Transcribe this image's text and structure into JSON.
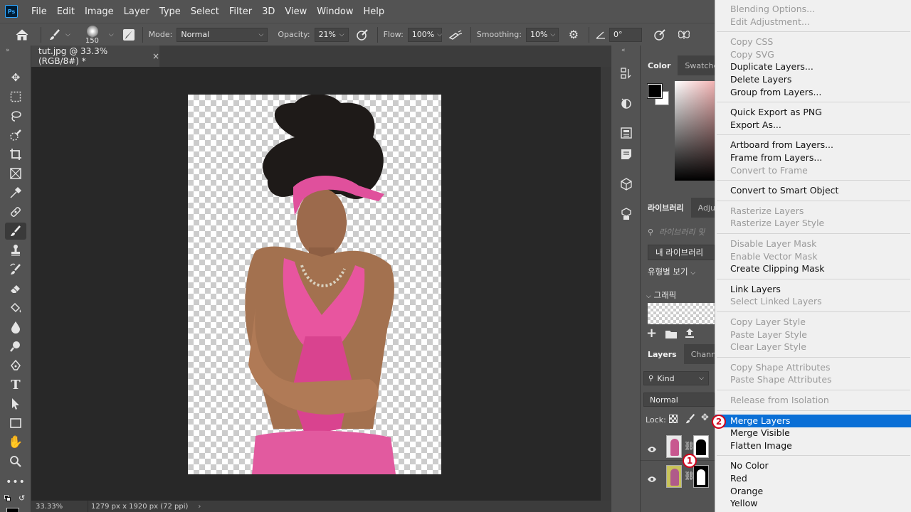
{
  "menubar": {
    "logo": "Ps",
    "items": [
      "File",
      "Edit",
      "Image",
      "Layer",
      "Type",
      "Select",
      "Filter",
      "3D",
      "View",
      "Window",
      "Help"
    ]
  },
  "options": {
    "brush_size": "150",
    "mode_label": "Mode:",
    "mode_value": "Normal",
    "opacity_label": "Opacity:",
    "opacity_value": "21%",
    "flow_label": "Flow:",
    "flow_value": "100%",
    "smoothing_label": "Smoothing:",
    "smoothing_value": "10%",
    "angle_value": "0°"
  },
  "document": {
    "tab_title": "tut.jpg @ 33.3% (RGB/8#) *",
    "close_glyph": "×",
    "zoom": "33.33%",
    "dimensions": "1279 px x 1920 px (72 ppi)"
  },
  "panels": {
    "color_tabs": [
      "Color",
      "Swatches"
    ],
    "library_tabs": [
      "라이브러리",
      "Adju"
    ],
    "library_search_placeholder": "라이브러리 및",
    "my_library": "내 라이브러리",
    "view_by_type": "유형별 보기",
    "graphics_label": "그래픽",
    "layers_tabs": [
      "Layers",
      "Channels"
    ],
    "kind_label": "Kind",
    "blend_mode": "Normal",
    "lock_label": "Lock:"
  },
  "context_menu": {
    "items": [
      {
        "label": "Blending Options...",
        "enabled": false
      },
      {
        "label": "Edit Adjustment...",
        "enabled": false
      },
      {
        "sep": true
      },
      {
        "label": "Copy CSS",
        "enabled": false
      },
      {
        "label": "Copy SVG",
        "enabled": false
      },
      {
        "label": "Duplicate Layers...",
        "enabled": true
      },
      {
        "label": "Delete Layers",
        "enabled": true
      },
      {
        "label": "Group from Layers...",
        "enabled": true
      },
      {
        "sep": true
      },
      {
        "label": "Quick Export as PNG",
        "enabled": true
      },
      {
        "label": "Export As...",
        "enabled": true
      },
      {
        "sep": true
      },
      {
        "label": "Artboard from Layers...",
        "enabled": true
      },
      {
        "label": "Frame from Layers...",
        "enabled": true
      },
      {
        "label": "Convert to Frame",
        "enabled": false
      },
      {
        "sep": true
      },
      {
        "label": "Convert to Smart Object",
        "enabled": true
      },
      {
        "sep": true
      },
      {
        "label": "Rasterize Layers",
        "enabled": false
      },
      {
        "label": "Rasterize Layer Style",
        "enabled": false
      },
      {
        "sep": true
      },
      {
        "label": "Disable Layer Mask",
        "enabled": false
      },
      {
        "label": "Enable Vector Mask",
        "enabled": false
      },
      {
        "label": "Create Clipping Mask",
        "enabled": true
      },
      {
        "sep": true
      },
      {
        "label": "Link Layers",
        "enabled": true
      },
      {
        "label": "Select Linked Layers",
        "enabled": false
      },
      {
        "sep": true
      },
      {
        "label": "Copy Layer Style",
        "enabled": false
      },
      {
        "label": "Paste Layer Style",
        "enabled": false
      },
      {
        "label": "Clear Layer Style",
        "enabled": false
      },
      {
        "sep": true
      },
      {
        "label": "Copy Shape Attributes",
        "enabled": false
      },
      {
        "label": "Paste Shape Attributes",
        "enabled": false
      },
      {
        "sep": true
      },
      {
        "label": "Release from Isolation",
        "enabled": false
      },
      {
        "sep": true
      },
      {
        "label": "Merge Layers",
        "enabled": true,
        "selected": true
      },
      {
        "label": "Merge Visible",
        "enabled": true
      },
      {
        "label": "Flatten Image",
        "enabled": true
      },
      {
        "sep": true
      },
      {
        "label": "No Color",
        "enabled": true
      },
      {
        "label": "Red",
        "enabled": true
      },
      {
        "label": "Orange",
        "enabled": true
      },
      {
        "label": "Yellow",
        "enabled": true
      }
    ]
  },
  "annotations": {
    "step1": "1",
    "step2": "2",
    "color": "#d0021b"
  },
  "colors": {
    "menu_selected": "#0a6fd6",
    "headband_pink": "#e0509c",
    "top_pink": "#e8559f",
    "skin": "#9c6a4c",
    "hair": "#1e1a18"
  }
}
